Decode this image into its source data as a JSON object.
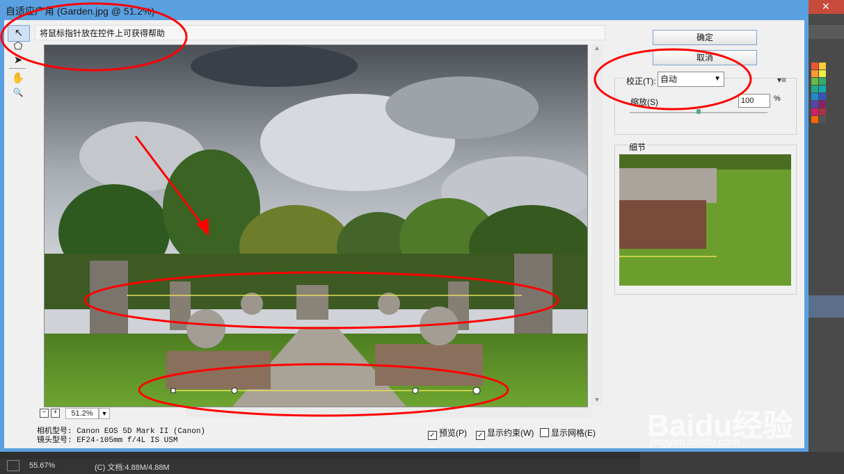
{
  "dialog": {
    "title": "自适应广角 (Garden.jpg @ 51.2%)",
    "close_label": "✕",
    "help_text": "将鼠标指针放在控件上可获得帮助"
  },
  "tools": [
    {
      "name": "constraint-tool-icon",
      "glyph": "↖"
    },
    {
      "name": "polygon-constraint-tool-icon",
      "glyph": "⬠"
    },
    {
      "name": "move-tool-icon",
      "glyph": "➤"
    },
    {
      "name": "hand-tool-icon",
      "glyph": "✋"
    },
    {
      "name": "zoom-tool-icon",
      "glyph": "🔍"
    }
  ],
  "buttons": {
    "ok": "确定",
    "cancel": "取消"
  },
  "correction": {
    "label": "校正(T):",
    "value": "自动",
    "scale_label": "缩放(S)",
    "scale_value": "100",
    "scale_unit": "%",
    "scale_level": 0.5,
    "menu_glyph": "▾≡"
  },
  "detail": {
    "label": "细节"
  },
  "zoom": {
    "minus": "−",
    "plus": "+",
    "value": "51.2%"
  },
  "camera": {
    "model": "相机型号: Canon EOS 5D Mark II (Canon)",
    "lens": "镜头型号: EF24-105mm f/4L IS USM"
  },
  "options": {
    "preview": "预览(P)",
    "show_constraints": "显示约束(W)",
    "show_grid": "显示网格(E)",
    "preview_checked": true,
    "constraints_checked": true,
    "grid_checked": false
  },
  "status": {
    "zoom": "55.67%",
    "doc": "(C) 文档:4.88M/4.88M"
  },
  "watermark": {
    "logo": "Baidu经验",
    "url": "jingyan.baidu.com"
  },
  "colors": {
    "titlebar": "#5aa0e0",
    "annotation": "#ff0000",
    "constraint_line": "#e6e05a"
  }
}
